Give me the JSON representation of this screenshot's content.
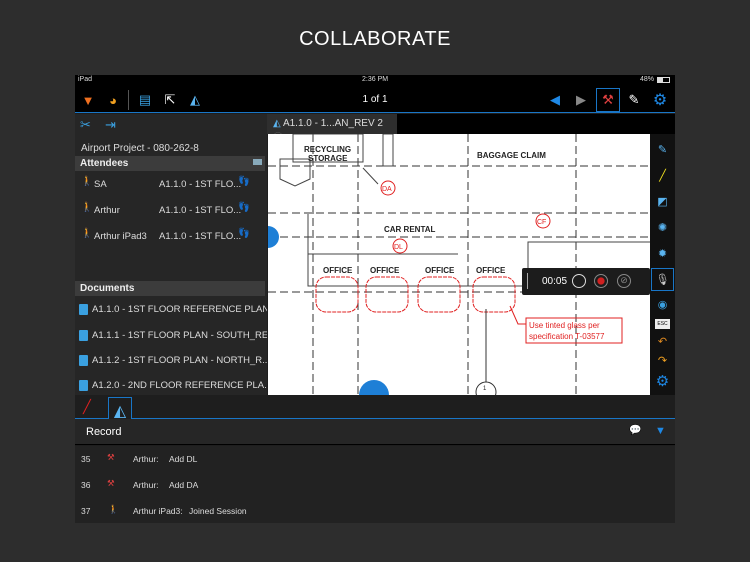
{
  "hero_title": "COLLABORATE",
  "status": {
    "device": "iPad",
    "time": "2:36 PM",
    "battery": "48%"
  },
  "toolbar": {
    "page_indicator": "1 of 1"
  },
  "left": {
    "project": "Airport Project - 080-262-8",
    "attendees_header": "Attendees",
    "attendees": [
      {
        "name": "SA",
        "document": "A1.1.0 - 1ST FLO..."
      },
      {
        "name": "Arthur",
        "document": "A1.1.0 - 1ST FLO..."
      },
      {
        "name": "Arthur iPad3",
        "document": "A1.1.0 - 1ST FLO..."
      }
    ],
    "documents_header": "Documents",
    "documents": [
      "A1.1.0 - 1ST FLOOR REFERENCE PLAN...",
      "A1.1.1 - 1ST FLOOR PLAN - SOUTH_RE...",
      "A1.1.2 - 1ST FLOOR PLAN - NORTH_R...",
      "A1.2.0 - 2ND FLOOR REFERENCE PLA..."
    ]
  },
  "doc_tab": {
    "label": "A1.1.0 - 1...AN_REV 2"
  },
  "drawing": {
    "rooms": [
      "RECYCLING",
      "STORAGE",
      "BAGGAGE CLAIM",
      "CAR RENTAL",
      "OFFICE",
      "OFFICE",
      "OFFICE",
      "OFFICE"
    ],
    "tags": [
      "DA",
      "DL",
      "CF"
    ],
    "callout_line1": "Use tinted glass per",
    "callout_line2": "specification T-03577",
    "grid_bubble": "1"
  },
  "recorder": {
    "time": "00:05"
  },
  "record": {
    "title": "Record",
    "rows": [
      {
        "num": "35",
        "user": "Arthur:",
        "action": "Add DL"
      },
      {
        "num": "36",
        "user": "Arthur:",
        "action": "Add DA"
      },
      {
        "num": "37",
        "user": "Arthur iPad3:",
        "action": "Joined Session"
      }
    ]
  },
  "colors": {
    "accent": "#1976c7",
    "markup": "#e02020",
    "attendee": "#f0a020"
  }
}
